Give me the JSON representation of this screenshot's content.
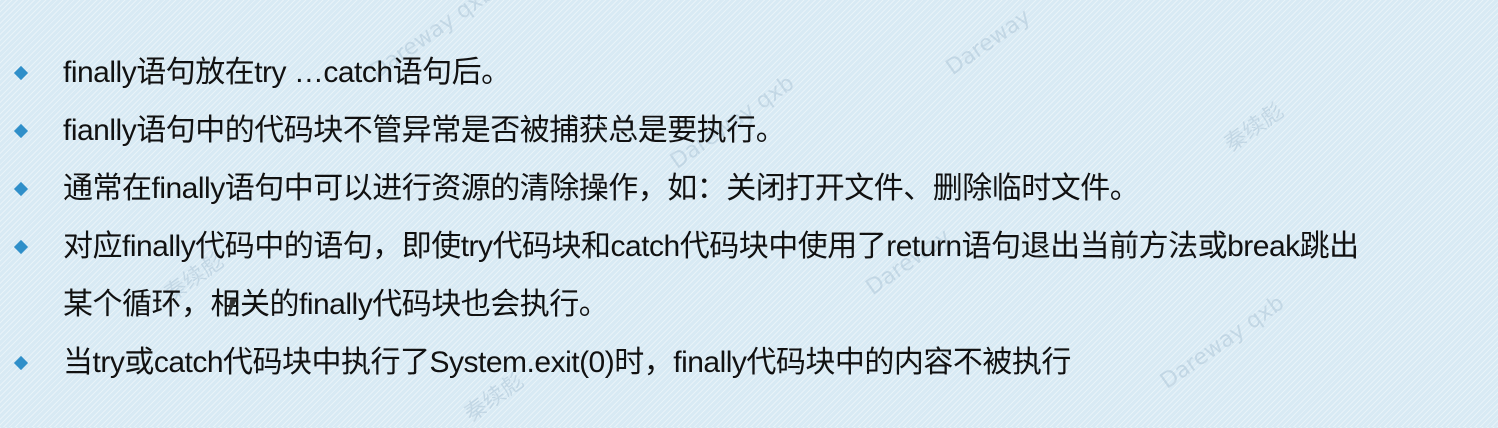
{
  "watermark": {
    "text_a": "Dareway qxb",
    "text_b": "秦续彪",
    "text_c": "Dareway"
  },
  "bullets": [
    {
      "lines": [
        "finally语句放在try …catch语句后。"
      ]
    },
    {
      "lines": [
        "fianlly语句中的代码块不管异常是否被捕获总是要执行。"
      ]
    },
    {
      "lines": [
        "通常在finally语句中可以进行资源的清除操作，如：关闭打开文件、删除临时文件。"
      ]
    },
    {
      "lines": [
        "对应finally代码中的语句，即使try代码块和catch代码块中使用了return语句退出当前方法或break跳出",
        "某个循环，相关的finally代码块也会执行。"
      ]
    },
    {
      "lines": [
        "当try或catch代码块中执行了System.exit(0)时，finally代码块中的内容不被执行"
      ]
    }
  ],
  "colors": {
    "background": "#dcecf5",
    "bullet_marker": "#2f8fc9",
    "text": "#111111"
  },
  "icons": {
    "bullet": "diamond-bullet-icon",
    "cursor": "mouse-pointer-icon"
  }
}
